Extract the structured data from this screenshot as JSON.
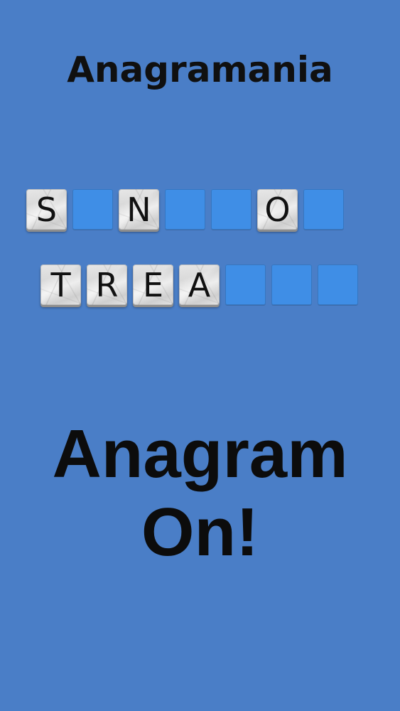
{
  "app": {
    "title": "Anagramania"
  },
  "board": {
    "row1": [
      {
        "letter": "S"
      },
      {
        "letter": ""
      },
      {
        "letter": "N"
      },
      {
        "letter": ""
      },
      {
        "letter": ""
      },
      {
        "letter": "O"
      },
      {
        "letter": ""
      }
    ],
    "row2": [
      {
        "letter": "T"
      },
      {
        "letter": "R"
      },
      {
        "letter": "E"
      },
      {
        "letter": "A"
      },
      {
        "letter": ""
      },
      {
        "letter": ""
      },
      {
        "letter": ""
      }
    ]
  },
  "colors": {
    "background": "#4a7ec7",
    "empty_tile": "#3f8ee6"
  },
  "tagline": {
    "line1": "Anagram",
    "line2": "On!"
  }
}
